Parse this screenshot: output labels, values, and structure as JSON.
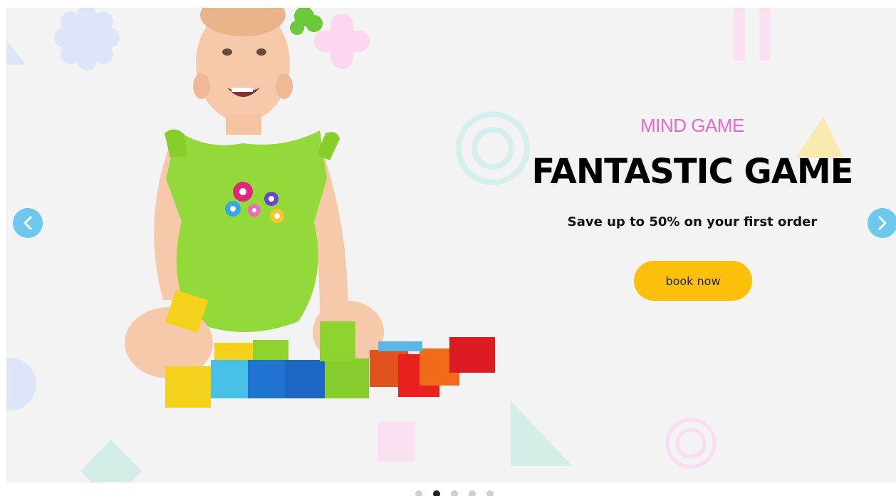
{
  "slider": {
    "subtitle": "MIND GAME",
    "title": "FANTASTIC GAME",
    "tagline": "Save up to 50% on your first order",
    "cta_label": "book now",
    "prev_icon": "chevron-left-icon",
    "next_icon": "chevron-right-icon",
    "dots": [
      {
        "active": false
      },
      {
        "active": true
      },
      {
        "active": false
      },
      {
        "active": false
      },
      {
        "active": false
      }
    ]
  },
  "colors": {
    "background": "#f3f3f3",
    "subtitle": "#e36ad2",
    "title": "#000000",
    "button": "#fcbf0a",
    "arrow": "#6cc8ee",
    "dot_active": "#222222",
    "dot_inactive": "#cfcfcf"
  }
}
